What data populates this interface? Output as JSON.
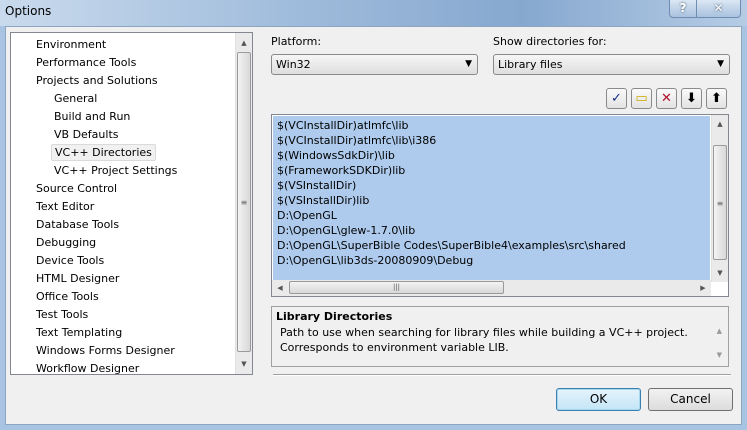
{
  "window": {
    "title": "Options",
    "help_label": "?",
    "close_label": "✕"
  },
  "tree": {
    "items": [
      {
        "label": "Environment",
        "level": 0
      },
      {
        "label": "Performance Tools",
        "level": 0
      },
      {
        "label": "Projects and Solutions",
        "level": 0
      },
      {
        "label": "General",
        "level": 1
      },
      {
        "label": "Build and Run",
        "level": 1
      },
      {
        "label": "VB Defaults",
        "level": 1
      },
      {
        "label": "VC++ Directories",
        "level": 1,
        "selected": true
      },
      {
        "label": "VC++ Project Settings",
        "level": 1
      },
      {
        "label": "Source Control",
        "level": 0
      },
      {
        "label": "Text Editor",
        "level": 0
      },
      {
        "label": "Database Tools",
        "level": 0
      },
      {
        "label": "Debugging",
        "level": 0
      },
      {
        "label": "Device Tools",
        "level": 0
      },
      {
        "label": "HTML Designer",
        "level": 0
      },
      {
        "label": "Office Tools",
        "level": 0
      },
      {
        "label": "Test Tools",
        "level": 0
      },
      {
        "label": "Text Templating",
        "level": 0
      },
      {
        "label": "Windows Forms Designer",
        "level": 0
      },
      {
        "label": "Workflow Designer",
        "level": 0
      }
    ]
  },
  "platform": {
    "label": "Platform:",
    "value": "Win32"
  },
  "show_dirs": {
    "label": "Show directories for:",
    "value": "Library files"
  },
  "toolbar": {
    "icons": [
      "checkmark-icon",
      "new-folder-icon",
      "delete-icon",
      "move-down-icon",
      "move-up-icon"
    ],
    "glyphs": [
      "✓",
      "▭",
      "✕",
      "⬇",
      "⬆"
    ]
  },
  "directories": [
    "$(VCInstallDir)atlmfc\\lib",
    "$(VCInstallDir)atlmfc\\lib\\i386",
    "$(WindowsSdkDir)\\lib",
    "$(FrameworkSDKDir)lib",
    "$(VSInstallDir)",
    "$(VSInstallDir)lib",
    "D:\\OpenGL",
    "D:\\OpenGL\\glew-1.7.0\\lib",
    "D:\\OpenGL\\SuperBible Codes\\SuperBible4\\examples\\src\\shared",
    "D:\\OpenGL\\lib3ds-20080909\\Debug"
  ],
  "description": {
    "title": "Library Directories",
    "text": "Path to use when searching for library files while building a VC++ project. Corresponds to environment variable LIB."
  },
  "buttons": {
    "ok": "OK",
    "cancel": "Cancel"
  }
}
